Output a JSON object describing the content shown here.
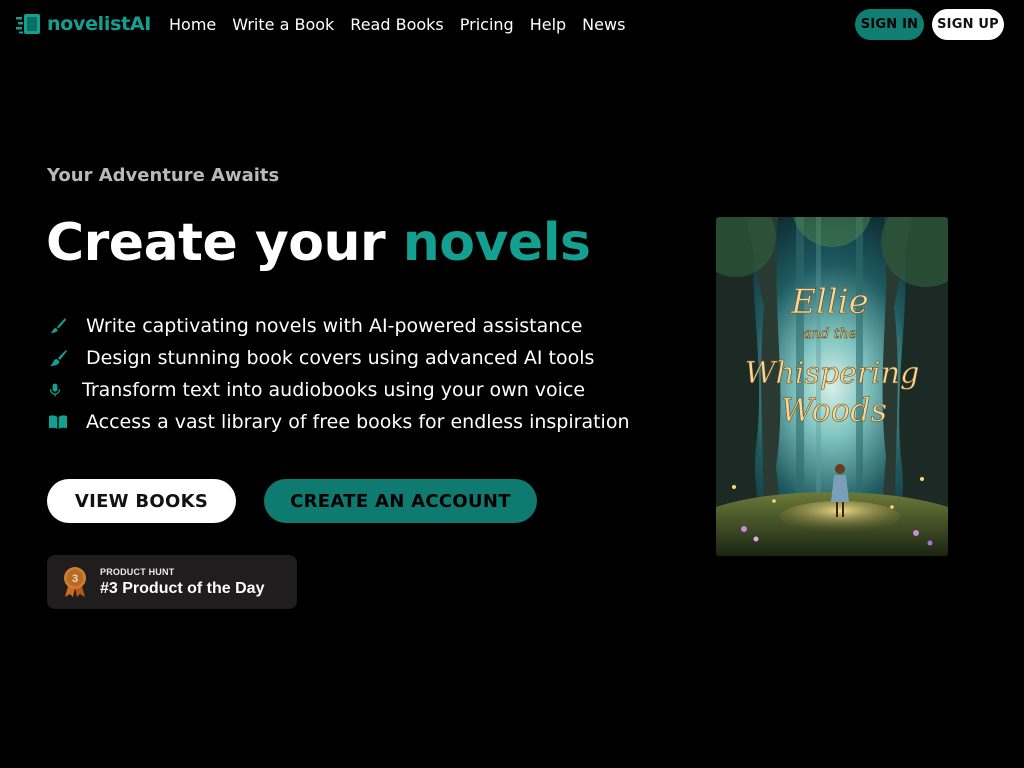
{
  "nav": {
    "logo_text": "novelistAI",
    "links": [
      "Home",
      "Write a Book",
      "Read Books",
      "Pricing",
      "Help",
      "News"
    ],
    "sign_in": "SIGN IN",
    "sign_up": "SIGN UP"
  },
  "hero": {
    "eyebrow": "Your Adventure Awaits",
    "headline_prefix": "Create your ",
    "headline_accent": "novels",
    "features": [
      {
        "icon": "brush-icon",
        "text": "Write captivating novels with AI-powered assistance"
      },
      {
        "icon": "paintbrush-icon",
        "text": "Design stunning book covers using advanced AI tools"
      },
      {
        "icon": "microphone-icon",
        "text": "Transform text into audiobooks using your own voice"
      },
      {
        "icon": "open-book-icon",
        "text": "Access a vast library of free books for endless inspiration"
      }
    ],
    "view_books": "VIEW BOOKS",
    "create_account": "CREATE AN ACCOUNT"
  },
  "product_hunt": {
    "rank": "3",
    "label": "PRODUCT HUNT",
    "title": "#3 Product of the Day"
  },
  "cover": {
    "line1": "Ellie",
    "line2": "and the",
    "line3": "Whispering",
    "line4": "Woods"
  },
  "colors": {
    "accent": "#14a090",
    "button_teal": "#0e7a70",
    "background": "#000000"
  }
}
